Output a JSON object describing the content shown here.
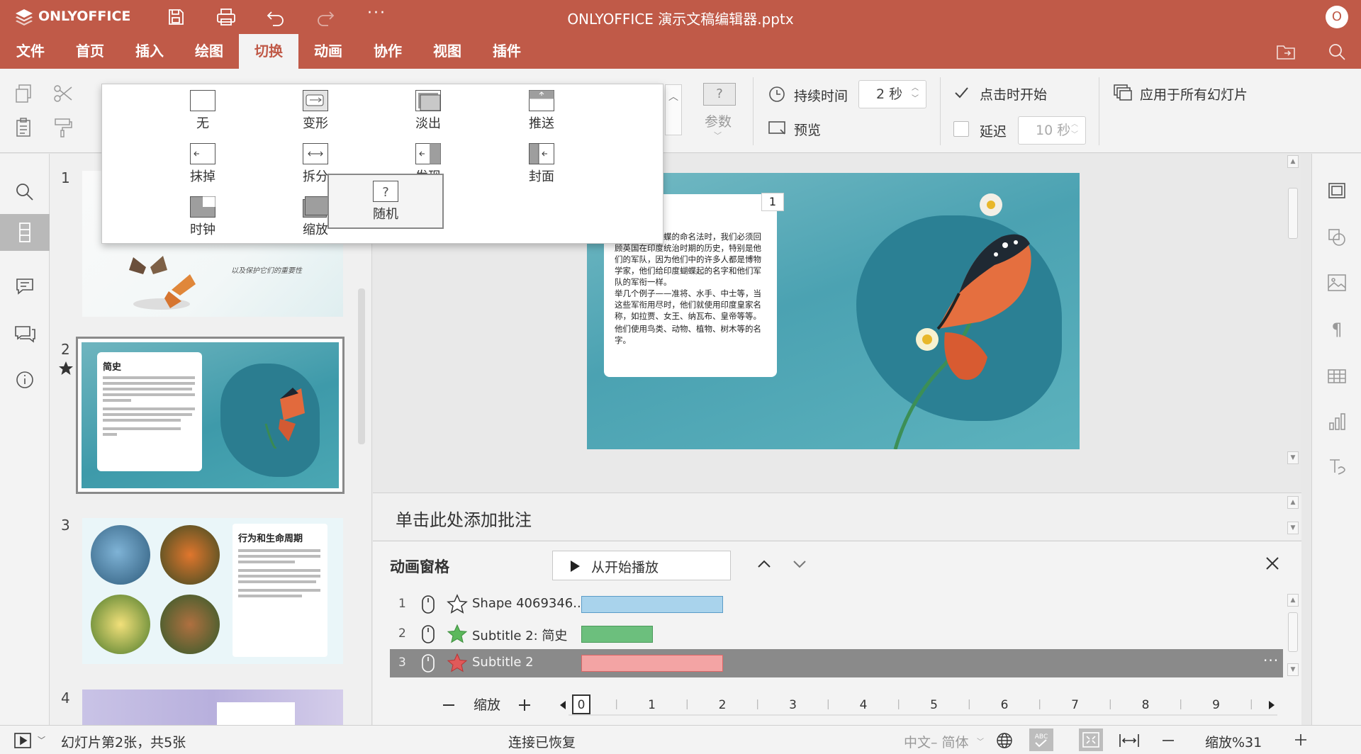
{
  "app": {
    "name": "ONLYOFFICE",
    "title": "ONLYOFFICE 演示文稿编辑器.pptx",
    "avatar_initial": "O",
    "brand_color": "#c05a48"
  },
  "menu": {
    "items": [
      {
        "label": "文件",
        "active": false
      },
      {
        "label": "首页",
        "active": false
      },
      {
        "label": "插入",
        "active": false
      },
      {
        "label": "绘图",
        "active": false
      },
      {
        "label": "切换",
        "active": true
      },
      {
        "label": "动画",
        "active": false
      },
      {
        "label": "协作",
        "active": false
      },
      {
        "label": "视图",
        "active": false
      },
      {
        "label": "插件",
        "active": false
      }
    ]
  },
  "transitions": {
    "items": [
      {
        "label": "无",
        "icon": "blank-icon"
      },
      {
        "label": "变形",
        "icon": "morph-icon"
      },
      {
        "label": "淡出",
        "icon": "fade-icon"
      },
      {
        "label": "推送",
        "icon": "push-icon"
      },
      {
        "label": "抹掉",
        "icon": "wipe-icon"
      },
      {
        "label": "拆分",
        "icon": "split-icon"
      },
      {
        "label": "发现",
        "icon": "uncover-icon"
      },
      {
        "label": "封面",
        "icon": "cover-icon"
      },
      {
        "label": "时钟",
        "icon": "clock-icon"
      },
      {
        "label": "缩放",
        "icon": "zoom-icon"
      },
      {
        "label": "随机",
        "icon": "random-icon",
        "selected": true
      }
    ],
    "params_label": "参数",
    "duration_label": "持续时间",
    "duration_value": "2 秒",
    "preview_label": "预览",
    "start_on_click_label": "点击时开始",
    "start_on_click_checked": true,
    "delay_label": "延迟",
    "delay_value": "10 秒",
    "delay_checked": false,
    "apply_all_label": "应用于所有幻灯片"
  },
  "thumbnails": [
    {
      "number": "1",
      "caption": "以及保护它们的重要性"
    },
    {
      "number": "2",
      "title": "简史",
      "has_animation": true,
      "selected": true
    },
    {
      "number": "3",
      "title": "行为和生命周期"
    },
    {
      "number": "4"
    }
  ],
  "slide": {
    "placeholder_number": "1",
    "para_number": "3",
    "paragraph1": "当我们谈论蝴蝶的命名法时，我们必须回顾英国在印度统治时期的历史，特别是他们的军队，因为他们中的许多人都是博物学家，他们给印度蝴蝶起的名字和他们军队的军衔一样。",
    "paragraph2": "举几个例子——准将、水手、中士等，当这些军衔用尽时，他们就使用印度皇家名称，如拉贾、女王、纳瓦布、皇帝等等。",
    "paragraph3": "他们使用鸟类、动物、植物、树木等的名字。"
  },
  "notes": {
    "placeholder": "单击此处添加批注"
  },
  "animation_pane": {
    "title": "动画窗格",
    "play_label": "从开始播放",
    "rows": [
      {
        "num": "1",
        "name": "Shape 4069346...",
        "color": "#a9d3ec",
        "star_color": "#ffffff",
        "selected": false,
        "bar": [
          0,
          1.0
        ]
      },
      {
        "num": "2",
        "name": "Subtitle 2: 简史",
        "color": "#6cbf7d",
        "star_color": "#5cb85c",
        "selected": false,
        "bar": [
          0,
          0.5
        ]
      },
      {
        "num": "3",
        "name": "Subtitle 2",
        "color": "#f3a4a4",
        "star_color": "#e05a5a",
        "selected": true,
        "bar": [
          0,
          1.0
        ]
      }
    ],
    "zoom_label": "缩放",
    "timeline_ticks": [
      "0",
      "1",
      "2",
      "3",
      "4",
      "5",
      "6",
      "7",
      "8",
      "9"
    ]
  },
  "status": {
    "slide_info": "幻灯片第2张，共5张",
    "connection": "连接已恢复",
    "language": "中文– 简体",
    "zoom": "缩放%31"
  }
}
